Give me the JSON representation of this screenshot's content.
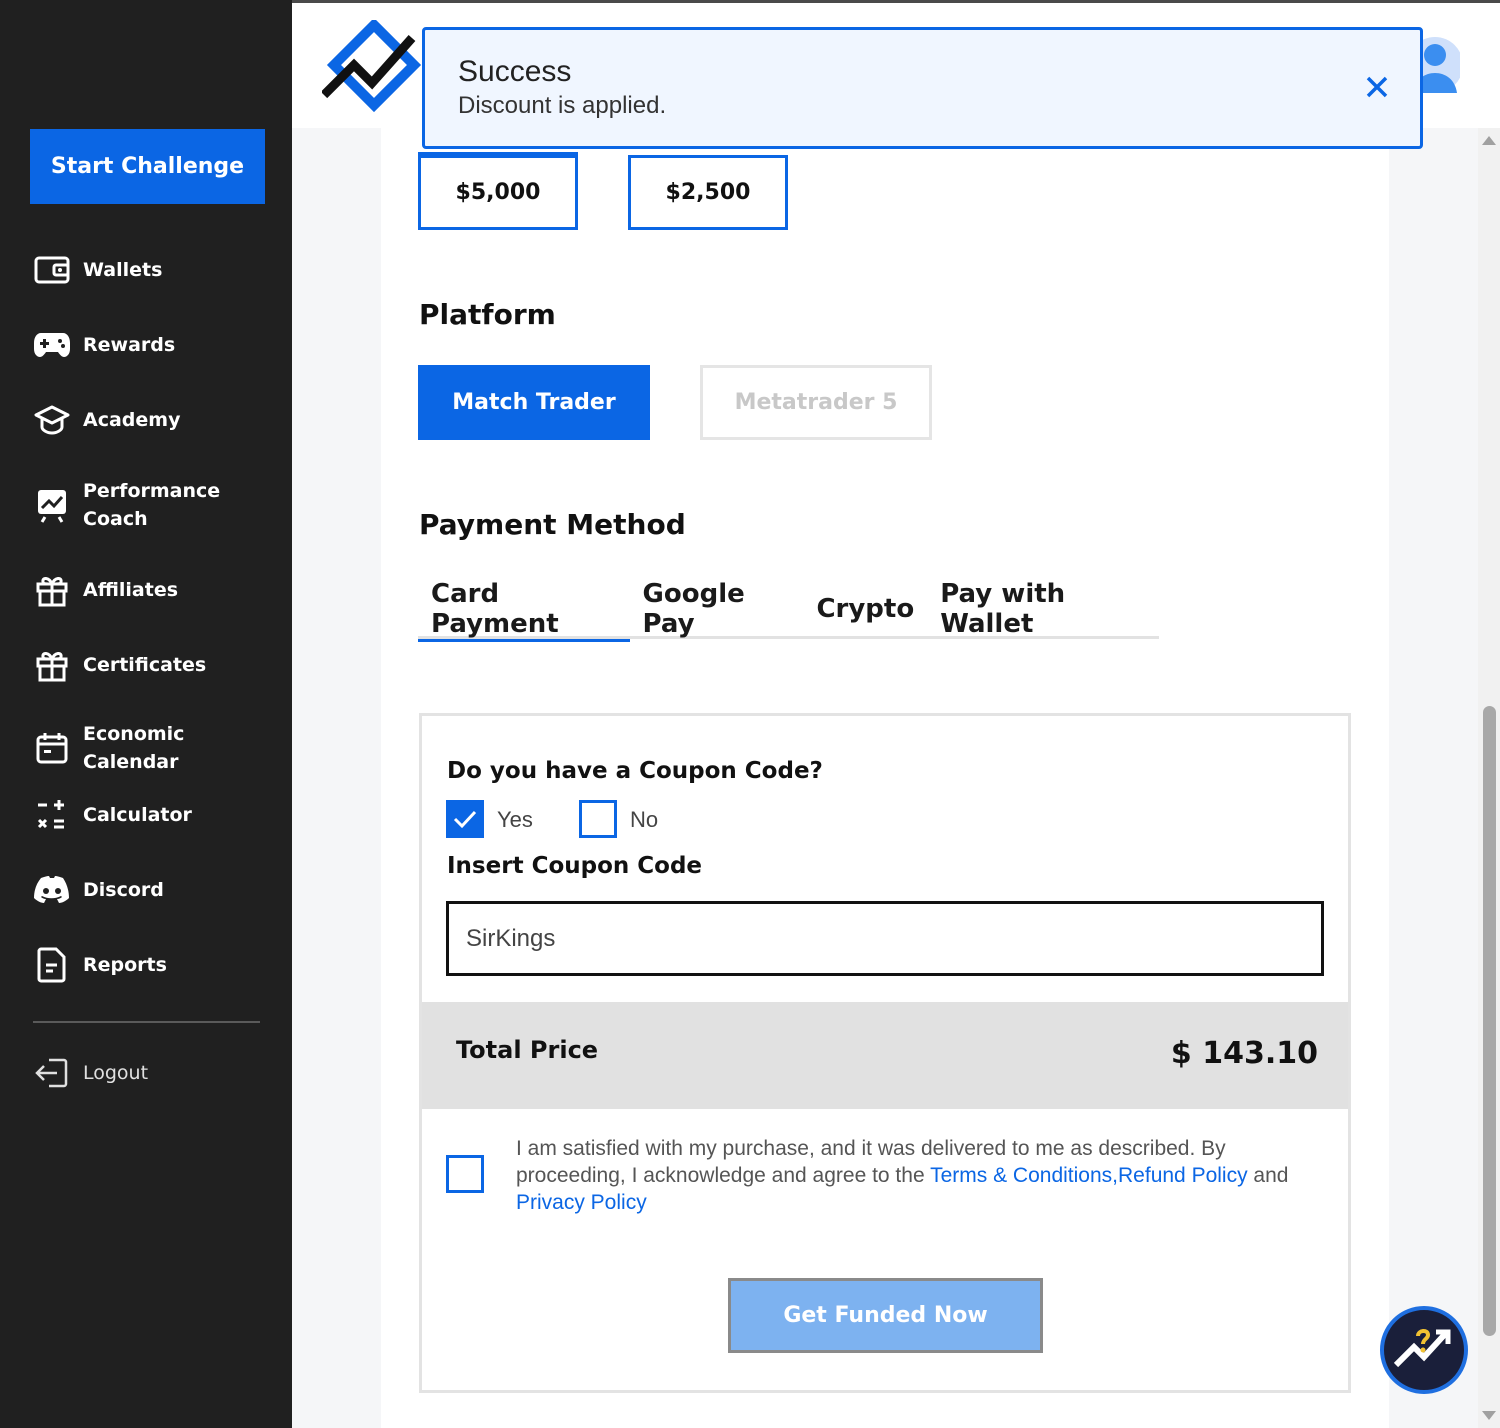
{
  "sidebar": {
    "start_label": "Start Challenge",
    "items": [
      {
        "label": "Wallets",
        "icon": "wallet-icon"
      },
      {
        "label": "Rewards",
        "icon": "gamepad-icon"
      },
      {
        "label": "Academy",
        "icon": "graduation-cap-icon"
      },
      {
        "label": "Performance Coach",
        "icon": "chart-coach-icon"
      },
      {
        "label": "Affiliates",
        "icon": "gift-icon"
      },
      {
        "label": "Certificates",
        "icon": "gift-icon"
      },
      {
        "label": "Economic Calendar",
        "icon": "calendar-icon"
      },
      {
        "label": "Calculator",
        "icon": "calculator-icon"
      },
      {
        "label": "Discord",
        "icon": "discord-icon"
      },
      {
        "label": "Reports",
        "icon": "report-icon"
      }
    ],
    "logout_label": "Logout"
  },
  "toast": {
    "title": "Success",
    "message": "Discount is applied."
  },
  "amounts": [
    "$5,000",
    "$2,500"
  ],
  "platform": {
    "title": "Platform",
    "options": [
      "Match Trader",
      "Metatrader 5"
    ],
    "selected": "Match Trader"
  },
  "payment": {
    "title": "Payment Method",
    "tabs": [
      "Card Payment",
      "Google Pay",
      "Crypto",
      "Pay with Wallet"
    ],
    "active_tab": "Card Payment"
  },
  "coupon": {
    "question": "Do you have a Coupon Code?",
    "yes_label": "Yes",
    "no_label": "No",
    "yes_checked": true,
    "insert_label": "Insert Coupon Code",
    "value": "SirKings"
  },
  "total": {
    "label": "Total Price",
    "value": "$ 143.10"
  },
  "agreement": {
    "text_before": "I am satisfied with my purchase, and it was delivered to me as described. By proceeding, I acknowledge and agree to the ",
    "terms_link": "Terms & Conditions",
    "comma": ",",
    "refund_link": "Refund Policy",
    "and_text": " and ",
    "privacy_link": "Privacy Policy"
  },
  "cta": {
    "label": "Get Funded Now"
  },
  "colors": {
    "accent": "#0b66e4",
    "sidebar_bg": "#202020",
    "disabled_cta": "#7db2f0"
  }
}
